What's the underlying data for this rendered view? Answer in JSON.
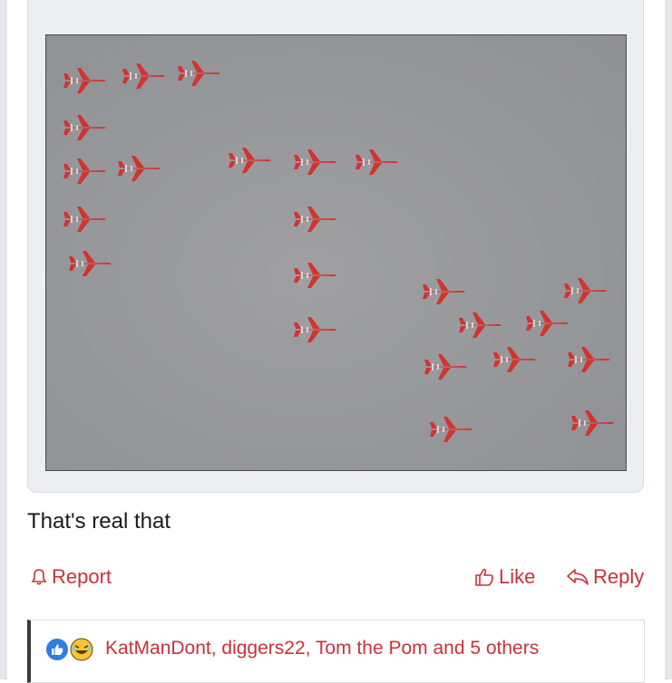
{
  "post": {
    "text": "That's real that",
    "image_alt": "Red jets flying in formation spelling a word"
  },
  "actions": {
    "report_label": "Report",
    "like_label": "Like",
    "reply_label": "Reply"
  },
  "reactions": {
    "names_text": "KatManDont, diggers22, Tom the Pom and 5 others",
    "icons": [
      "like-icon",
      "laugh-icon"
    ]
  },
  "colors": {
    "accent": "#c8323c",
    "like_blue": "#2f7de1",
    "jet_red": "#d2342f"
  }
}
